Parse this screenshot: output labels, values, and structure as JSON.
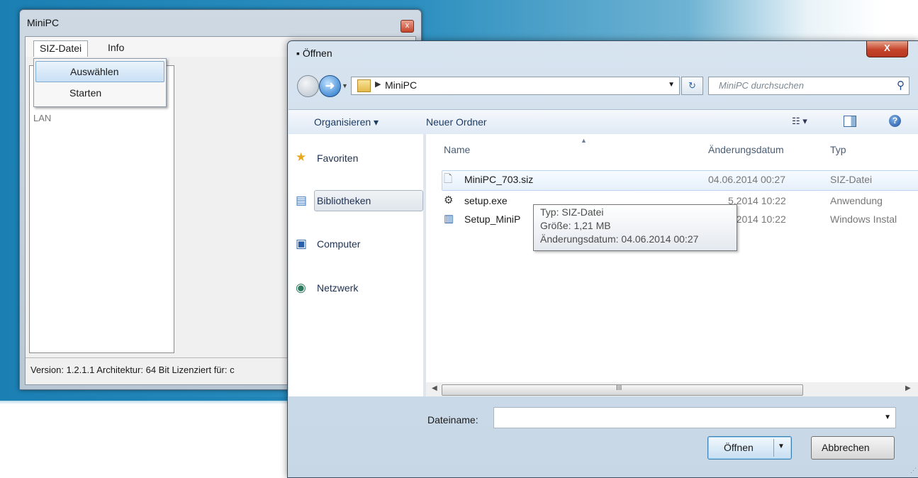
{
  "minipc": {
    "title": "MiniPC",
    "close_glyph": "x",
    "menus": [
      "SIZ-Datei",
      "Info"
    ],
    "dropdown": [
      "Auswählen",
      "Starten"
    ],
    "list_items": [
      "LAN"
    ],
    "status": "Version: 1.2.1.1 Architektur: 64 Bit Lizenziert für: c"
  },
  "dialog": {
    "title": "Öffnen",
    "close_glyph": "X",
    "address": "MiniPC",
    "search_placeholder": "MiniPC durchsuchen",
    "toolbar": {
      "organize": "Organisieren ▾",
      "new_folder": "Neuer Ordner"
    },
    "nav": [
      {
        "label": "Favoriten",
        "icon": "star-icon"
      },
      {
        "label": "Bibliotheken",
        "icon": "library-icon"
      },
      {
        "label": "Computer",
        "icon": "computer-icon"
      },
      {
        "label": "Netzwerk",
        "icon": "network-icon"
      }
    ],
    "columns": {
      "name": "Name",
      "date": "Änderungsdatum",
      "type": "Typ"
    },
    "files": [
      {
        "name": "MiniPC_703.siz",
        "date": "04.06.2014 00:27",
        "type": "SIZ-Datei",
        "icon": "document-icon"
      },
      {
        "name": "setup.exe",
        "date": "5.2014 10:22",
        "type": "Anwendung",
        "icon": "setup-icon"
      },
      {
        "name": "Setup_MiniP",
        "date": "5.2014 10:22",
        "type": "Windows Instal",
        "icon": "installer-icon"
      }
    ],
    "tooltip": [
      "Typ: SIZ-Datei",
      "Größe: 1,21 MB",
      "Änderungsdatum: 04.06.2014 00:27"
    ],
    "scroll_grip": "III",
    "filename_label": "Dateiname:",
    "filename_value": "",
    "open_button": "Öffnen",
    "cancel_button": "Abbrechen"
  }
}
